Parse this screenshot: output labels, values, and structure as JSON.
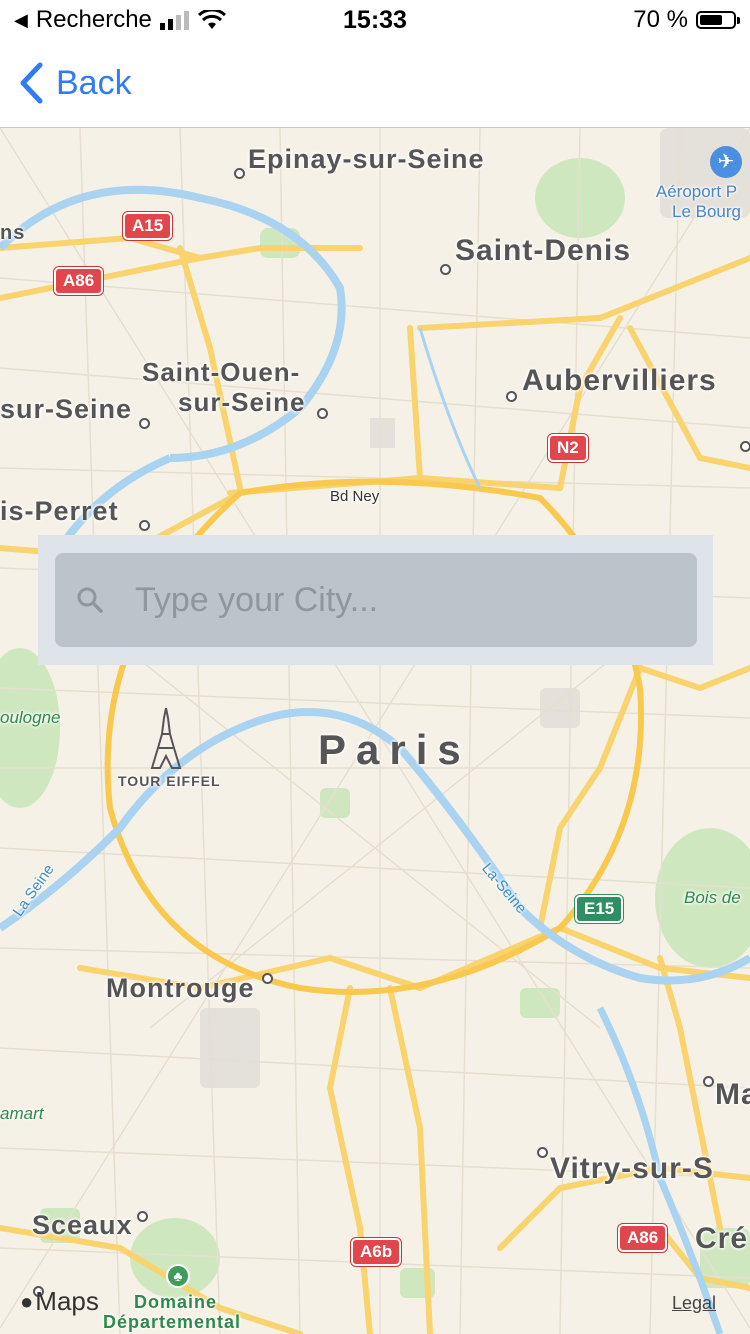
{
  "status_bar": {
    "back_app": "Recherche",
    "time": "15:33",
    "battery": "70 %",
    "battery_level": 0.7
  },
  "nav": {
    "back_label": "Back"
  },
  "search": {
    "placeholder": "Type your City...",
    "value": ""
  },
  "map": {
    "cities": {
      "epinay": "Epinay-sur-Seine",
      "saint_denis": "Saint-Denis",
      "saint_ouen_1": "Saint-Ouen-",
      "saint_ouen_2": "sur-Seine",
      "aubervilliers": "Aubervilliers",
      "asnieres": "sur-Seine",
      "levallois": "is-Perret",
      "paris": "Paris",
      "montrouge": "Montrouge",
      "vitry": "Vitry-sur-S",
      "sceaux": "Sceaux",
      "creteil": "Cré",
      "maisons": "Ma",
      "gennevilliers": "ns"
    },
    "streets": {
      "bd_ney": "Bd Ney"
    },
    "rivers": {
      "seine_west": "La Seine",
      "seine_east": "La-Seine"
    },
    "greens": {
      "boulogne": "oulogne",
      "bois": "Bois de",
      "clamart": "amart",
      "domaine_1": "Domaine",
      "domaine_2": "Départemental"
    },
    "poi": {
      "tour_eiffel": "TOUR EIFFEL"
    },
    "airport": {
      "line1": "Aéroport P",
      "line2": "Le Bourg"
    },
    "shields": [
      "A15",
      "A86",
      "N2",
      "E15",
      "A6b",
      "A86"
    ],
    "legal": "Legal",
    "maps_logo": "Maps"
  }
}
